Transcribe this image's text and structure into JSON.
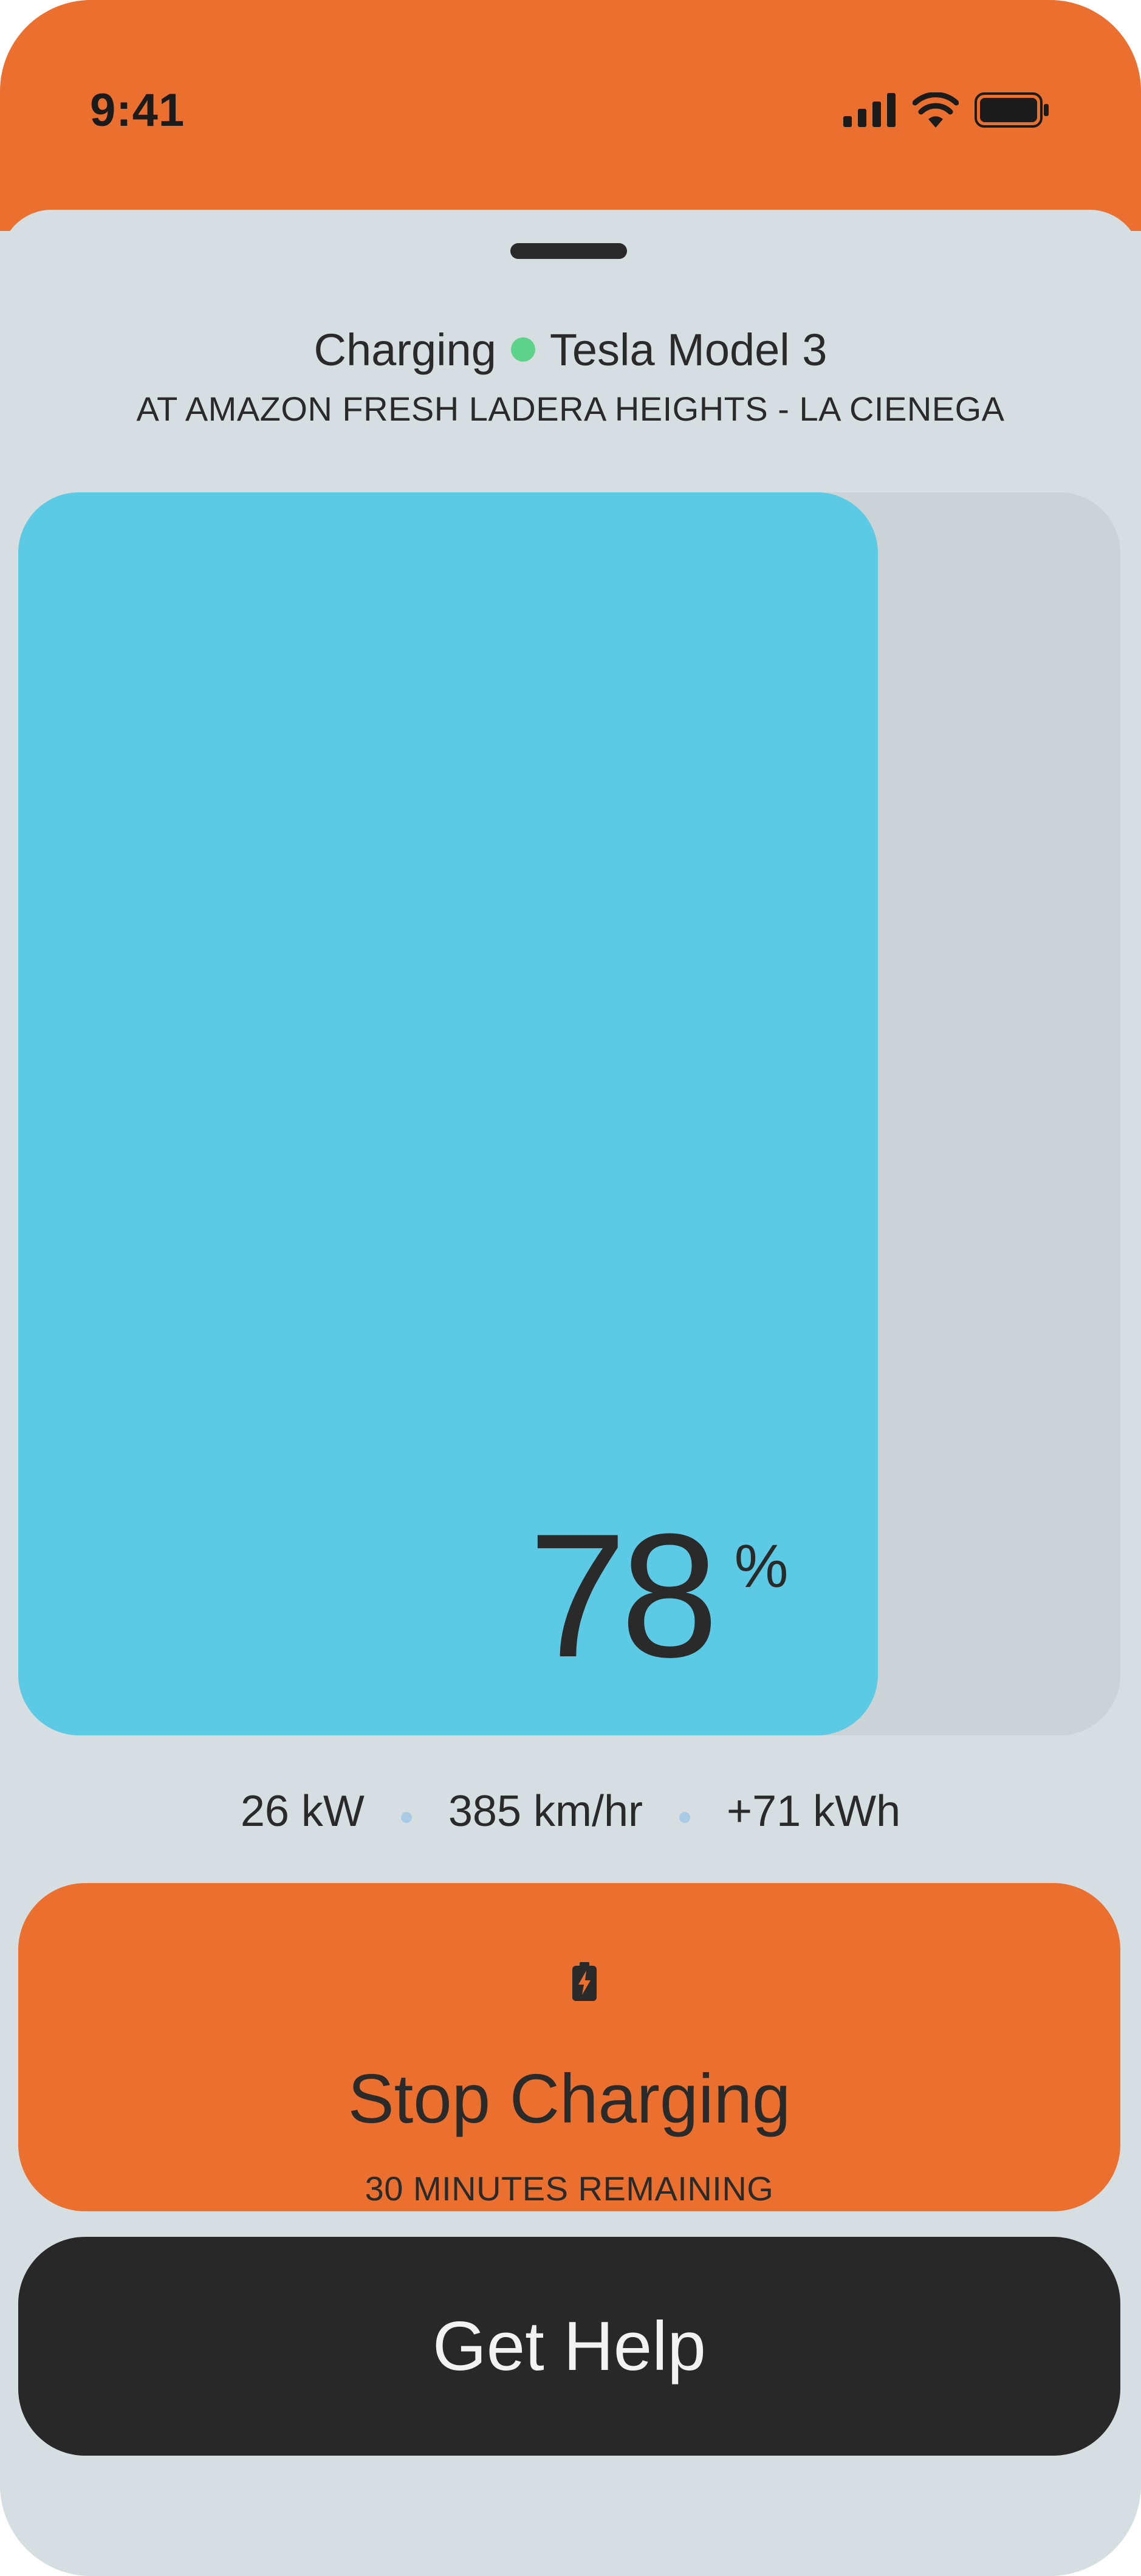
{
  "status_bar": {
    "time": "9:41",
    "icons": [
      "signal-icon",
      "wifi-icon",
      "battery-icon"
    ],
    "background": "#EB6F2E"
  },
  "header": {
    "state": "Charging",
    "state_color": "#5ED38C",
    "vehicle": "Tesla Model 3",
    "location": "AT AMAZON FRESH LADERA HEIGHTS - LA CIENEGA"
  },
  "battery": {
    "percent": "78",
    "unit": "%",
    "fill_fraction": 0.78,
    "fill_color": "#5CCAE4"
  },
  "stats": {
    "power": "26 kW",
    "rate": "385 km/hr",
    "energy": "+71 kWh"
  },
  "actions": {
    "stop": {
      "icon": "battery-charging-icon",
      "label": "Stop Charging",
      "subtitle": "30 MINUTES REMAINING",
      "color": "#EB6F2E"
    },
    "help": {
      "label": "Get Help",
      "color": "#282828"
    }
  }
}
